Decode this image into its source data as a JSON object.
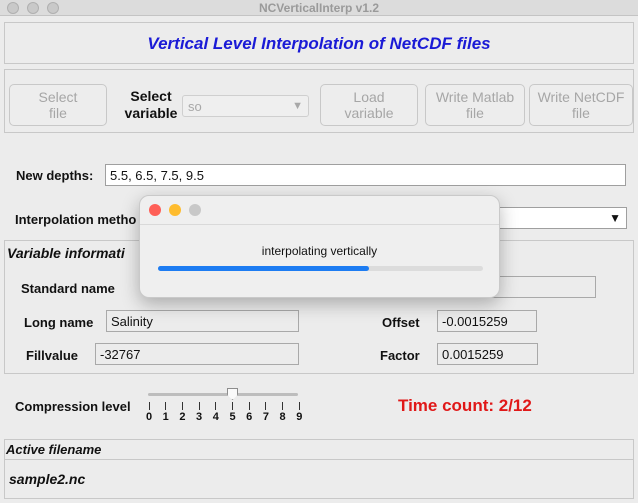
{
  "window": {
    "title": "NCVerticalInterp v1.2"
  },
  "header": {
    "heading": "Vertical Level Interpolation of NetCDF files"
  },
  "toolbar": {
    "select_file": [
      "Select",
      "file"
    ],
    "select_variable_label": [
      "Select",
      "variable"
    ],
    "variable_select_value": "so",
    "load_variable": [
      "Load",
      "variable"
    ],
    "write_matlab": [
      "Write Matlab",
      "file"
    ],
    "write_netcdf": [
      "Write NetCDF",
      "file"
    ]
  },
  "depths": {
    "label": "New depths:",
    "value": "5.5, 6.5, 7.5, 9.5"
  },
  "interp": {
    "label": "Interpolation metho"
  },
  "var_info": {
    "title": "Variable informati",
    "standard_name_label": "Standard name",
    "standard_name_value": "",
    "long_name_label": "Long name",
    "long_name_value": "Salinity",
    "fillvalue_label": "Fillvalue",
    "fillvalue_value": "-32767",
    "offset_label": "Offset",
    "offset_value": "-0.0015259",
    "factor_label": "Factor",
    "factor_value": "0.0015259"
  },
  "compression": {
    "label": "Compression level",
    "ticks": [
      "0",
      "1",
      "2",
      "3",
      "4",
      "5",
      "6",
      "7",
      "8",
      "9"
    ],
    "level": 5
  },
  "time_count": "Time count: 2/12",
  "file": {
    "header": "Active filename",
    "name": "sample2.nc"
  },
  "dialog": {
    "message": "interpolating vertically",
    "progress": 0.65,
    "colors": {
      "close": "#fe5f57",
      "minimize": "#febc2e",
      "zoom": "#c8c8c8",
      "bar": "#1d7cf2"
    }
  },
  "colors": {
    "heading": "#1a1ad6",
    "time_count": "#e01818"
  }
}
